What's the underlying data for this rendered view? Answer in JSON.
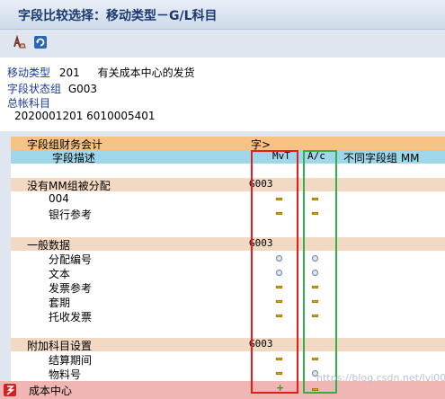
{
  "window": {
    "title": "字段比较选择：移动类型－G/L科目"
  },
  "toolbar": {
    "buttons": [
      "print-icon",
      "refresh-icon"
    ]
  },
  "info": {
    "movement_label": "移动类型",
    "movement_value": "201",
    "movement_desc": "有关成本中心的发货",
    "fsg_label": "字段状态组",
    "fsg_value": "G003",
    "gl_label": "总帐科目",
    "gl_value": "2020001201 6010005401"
  },
  "table": {
    "header1": {
      "label": "字段组财务会计",
      "right": "字>"
    },
    "header2": {
      "label": "字段描述",
      "col_mvt": "MvT",
      "col_ac": "A/c",
      "col_diff": "不同字段组 MM"
    },
    "groups": [
      {
        "title": "没有MM组被分配",
        "code": "G003",
        "rows": [
          {
            "label": "004",
            "mvt": "dash",
            "ac": "dash"
          },
          {
            "label": "银行参考",
            "mvt": "dash",
            "ac": "dash"
          }
        ]
      },
      {
        "title": "一般数据",
        "code": "G003",
        "rows": [
          {
            "label": "分配编号",
            "mvt": "circle",
            "ac": "circle"
          },
          {
            "label": "文本",
            "mvt": "circle",
            "ac": "circle"
          },
          {
            "label": "发票参考",
            "mvt": "dash",
            "ac": "dash"
          },
          {
            "label": "套期",
            "mvt": "dash",
            "ac": "dash"
          },
          {
            "label": "托收发票",
            "mvt": "dash",
            "ac": "dash"
          }
        ]
      },
      {
        "title": "附加科目设置",
        "code": "G003",
        "rows": [
          {
            "label": "结算期间",
            "mvt": "dash",
            "ac": "dash"
          },
          {
            "label": "物料号",
            "mvt": "dash",
            "ac": "circle"
          },
          {
            "label": "成本中心",
            "mvt": "plus",
            "ac": "dash"
          }
        ]
      }
    ]
  },
  "status": {
    "watermark": "https://blog.csdn.net/lvj003"
  }
}
